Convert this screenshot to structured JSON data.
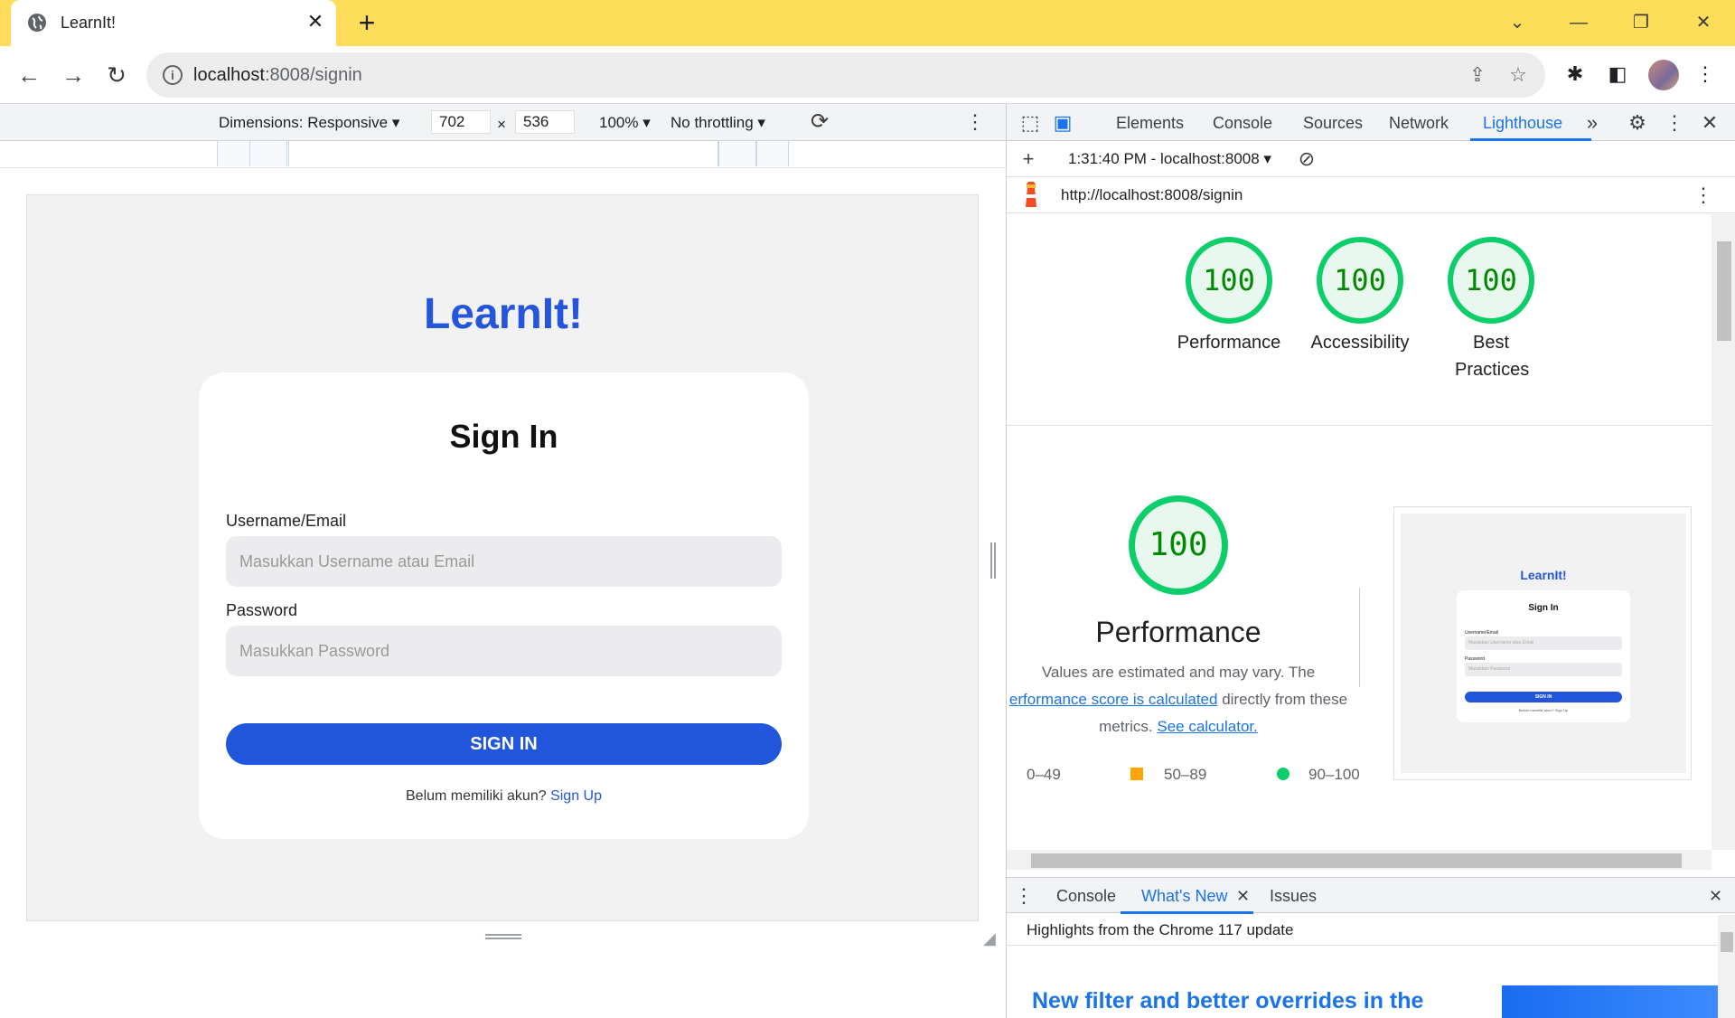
{
  "browser": {
    "tab_title": "LearnIt!",
    "url_host": "localhost",
    "url_path": ":8008/signin"
  },
  "device_toolbar": {
    "dimensions_label": "Dimensions: Responsive",
    "width": "702",
    "height": "536",
    "times": "×",
    "zoom": "100%",
    "throttling": "No throttling"
  },
  "page": {
    "brand": "LearnIt!",
    "card_title": "Sign In",
    "username_label": "Username/Email",
    "username_placeholder": "Masukkan Username atau Email",
    "password_label": "Password",
    "password_placeholder": "Masukkan Password",
    "signin_button": "SIGN IN",
    "signup_prompt": "Belum memiliki akun?",
    "signup_link": "Sign Up"
  },
  "devtools": {
    "tabs": [
      "Elements",
      "Console",
      "Sources",
      "Network",
      "Lighthouse"
    ],
    "active_tab": "Lighthouse",
    "report_selector": "1:31:40 PM - localhost:8008",
    "report_url": "http://localhost:8008/signin",
    "scores": [
      {
        "label": "Performance",
        "value": "100"
      },
      {
        "label": "Accessibility",
        "value": "100"
      },
      {
        "label": "Best Practices",
        "value": "100"
      }
    ],
    "performance": {
      "score": "100",
      "title": "Performance",
      "desc_1": "Values are estimated and may vary. The",
      "desc_link_1": "erformance score is calculated",
      "desc_2": "directly from these",
      "desc_3": "metrics.",
      "desc_link_2": "See calculator."
    },
    "legend": {
      "low": "0–49",
      "mid": "50–89",
      "high": "90–100",
      "mid_color": "#ffa400",
      "high_color": "#0cce6b"
    },
    "thumbnail": {
      "brand": "LearnIt!",
      "title": "Sign In",
      "username_label": "Username/Email",
      "username_placeholder": "Masukkan Username atau Email",
      "password_label": "Password",
      "password_placeholder": "Masukkan Password",
      "button": "SIGN IN",
      "footer": "Belum memiliki akun? Sign Up"
    },
    "drawer": {
      "tabs": [
        "Console",
        "What's New",
        "Issues"
      ],
      "active_tab": "What's New",
      "highlights": "Highlights from the Chrome 117 update",
      "headline": "New filter and better overrides in the"
    }
  },
  "colors": {
    "titlebar": "#fedd5b",
    "brand_blue": "#2555db",
    "button_blue": "#2155dc",
    "score_green": "#0cce6b",
    "devtools_accent": "#1a73e8"
  }
}
